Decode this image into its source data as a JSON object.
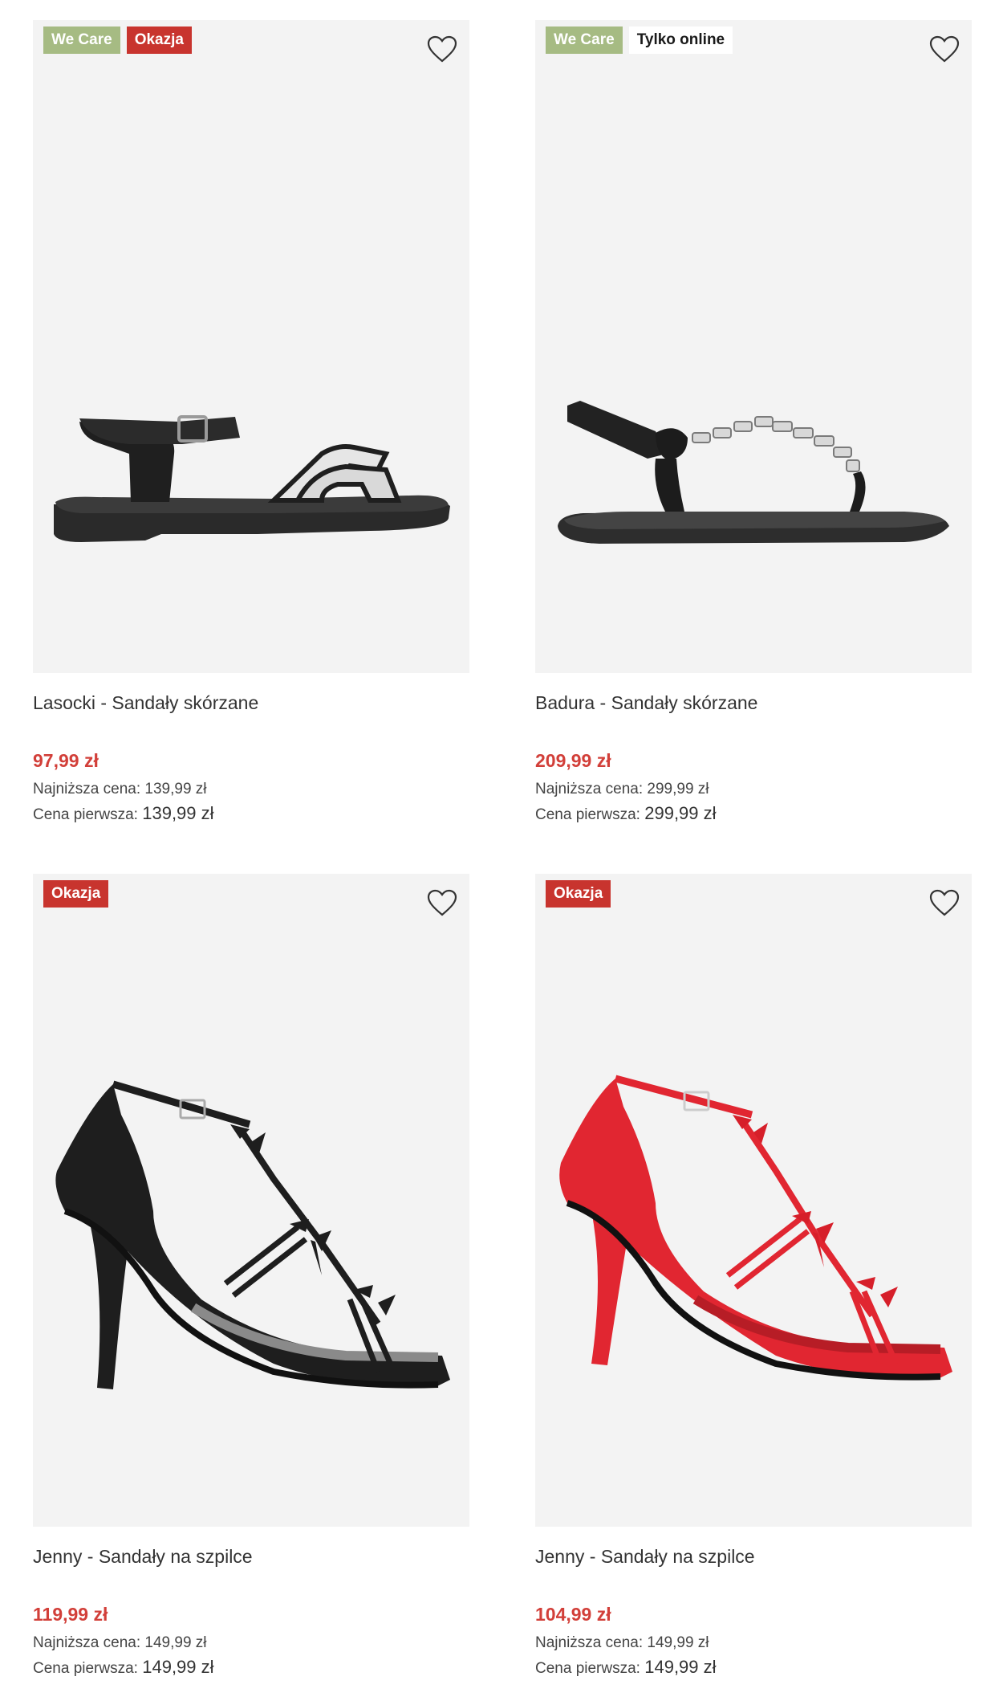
{
  "colors": {
    "sale_price": "#d23f39",
    "badge_green": "#a6bb83",
    "badge_red": "#c8342e",
    "tile_bg": "#f3f3f3"
  },
  "labels": {
    "lowest": "Najniższa cena:",
    "first": "Cena pierwsza:"
  },
  "products": [
    {
      "name": "Lasocki - Sandały skórzane",
      "price": "97,99 zł",
      "lowest_price": "139,99 zł",
      "first_price": "139,99 zł",
      "badges": [
        "We Care",
        "Okazja"
      ],
      "image": "black-white-leather-sandal"
    },
    {
      "name": "Badura - Sandały skórzane",
      "price": "209,99 zł",
      "lowest_price": "299,99 zł",
      "first_price": "299,99 zł",
      "badges": [
        "We Care",
        "Tylko online"
      ],
      "image": "black-thong-sandal-with-crystals"
    },
    {
      "name": "Jenny - Sandały na szpilce",
      "price": "119,99 zł",
      "lowest_price": "149,99 zł",
      "first_price": "149,99 zł",
      "badges": [
        "Okazja"
      ],
      "image": "black-satin-stiletto-sandal"
    },
    {
      "name": "Jenny - Sandały na szpilce",
      "price": "104,99 zł",
      "lowest_price": "149,99 zł",
      "first_price": "149,99 zł",
      "badges": [
        "Okazja"
      ],
      "image": "red-satin-stiletto-sandal"
    }
  ]
}
